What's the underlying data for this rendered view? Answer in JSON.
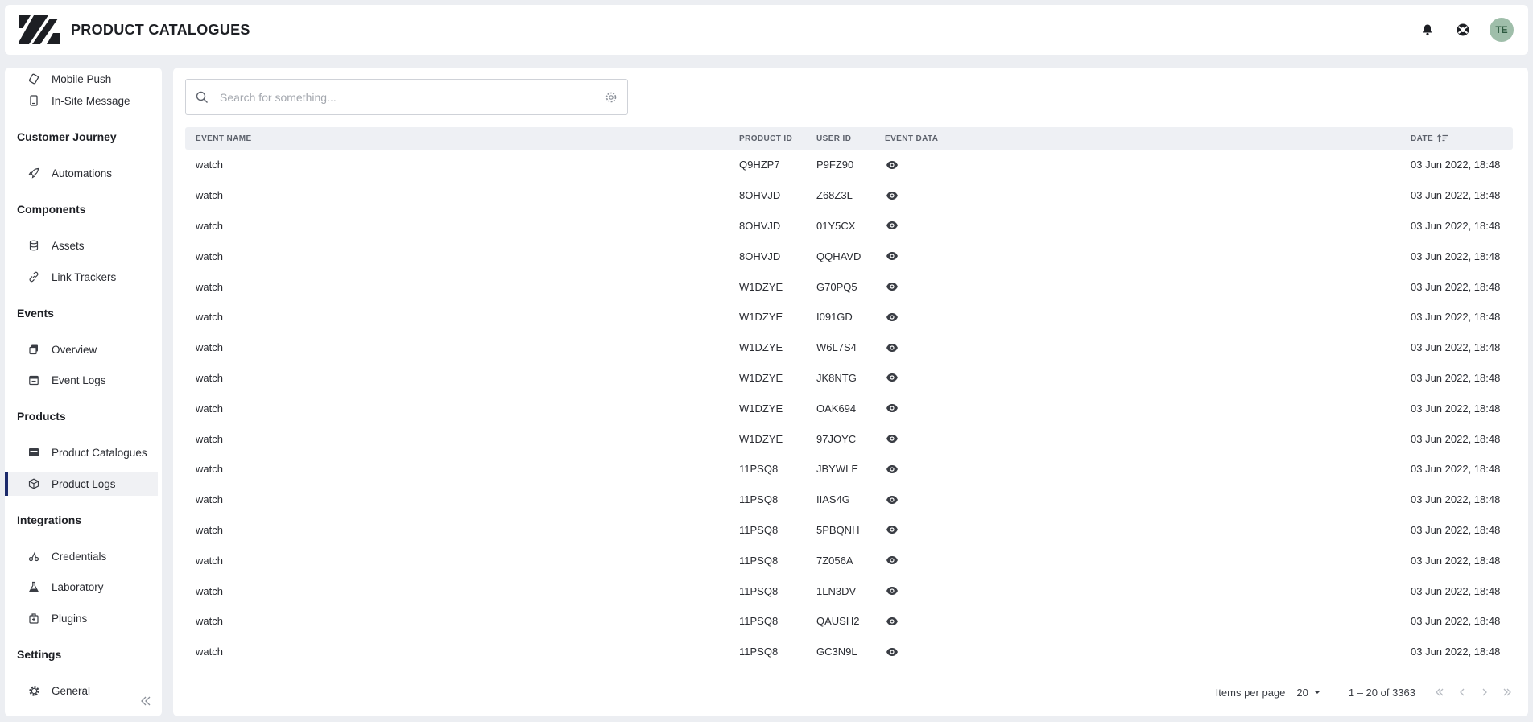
{
  "header": {
    "title": "PRODUCT CATALOGUES",
    "avatar_initials": "TE",
    "icons": [
      "bell-icon",
      "help-icon"
    ]
  },
  "sidebar": {
    "items_top": [
      {
        "label": "Mobile Push",
        "icon": "mobile-push-icon"
      },
      {
        "label": "In-Site Message",
        "icon": "tablet-icon"
      }
    ],
    "sections": [
      {
        "title": "Customer Journey",
        "items": [
          {
            "label": "Automations",
            "icon": "rocket-icon"
          }
        ]
      },
      {
        "title": "Components",
        "items": [
          {
            "label": "Assets",
            "icon": "database-icon"
          },
          {
            "label": "Link Trackers",
            "icon": "link-icon"
          }
        ]
      },
      {
        "title": "Events",
        "items": [
          {
            "label": "Overview",
            "icon": "layers-icon"
          },
          {
            "label": "Event Logs",
            "icon": "calendar-icon"
          }
        ]
      },
      {
        "title": "Products",
        "items": [
          {
            "label": "Product Catalogues",
            "icon": "catalog-icon"
          },
          {
            "label": "Product Logs",
            "icon": "cube-icon"
          }
        ]
      },
      {
        "title": "Integrations",
        "items": [
          {
            "label": "Credentials",
            "icon": "credentials-icon"
          },
          {
            "label": "Laboratory",
            "icon": "flask-icon"
          },
          {
            "label": "Plugins",
            "icon": "plugin-icon"
          }
        ]
      },
      {
        "title": "Settings",
        "items": [
          {
            "label": "General",
            "icon": "gear-icon"
          }
        ]
      }
    ],
    "active": "Product Logs"
  },
  "search": {
    "placeholder": "Search for something...",
    "value": ""
  },
  "table": {
    "columns": {
      "event_name": "EVENT NAME",
      "product_id": "PRODUCT ID",
      "user_id": "USER ID",
      "event_data": "EVENT DATA",
      "date": "DATE"
    },
    "rows": [
      {
        "event_name": "watch",
        "product_id": "Q9HZP7",
        "user_id": "P9FZ90",
        "date": "03 Jun 2022, 18:48"
      },
      {
        "event_name": "watch",
        "product_id": "8OHVJD",
        "user_id": "Z68Z3L",
        "date": "03 Jun 2022, 18:48"
      },
      {
        "event_name": "watch",
        "product_id": "8OHVJD",
        "user_id": "01Y5CX",
        "date": "03 Jun 2022, 18:48"
      },
      {
        "event_name": "watch",
        "product_id": "8OHVJD",
        "user_id": "QQHAVD",
        "date": "03 Jun 2022, 18:48"
      },
      {
        "event_name": "watch",
        "product_id": "W1DZYE",
        "user_id": "G70PQ5",
        "date": "03 Jun 2022, 18:48"
      },
      {
        "event_name": "watch",
        "product_id": "W1DZYE",
        "user_id": "I091GD",
        "date": "03 Jun 2022, 18:48"
      },
      {
        "event_name": "watch",
        "product_id": "W1DZYE",
        "user_id": "W6L7S4",
        "date": "03 Jun 2022, 18:48"
      },
      {
        "event_name": "watch",
        "product_id": "W1DZYE",
        "user_id": "JK8NTG",
        "date": "03 Jun 2022, 18:48"
      },
      {
        "event_name": "watch",
        "product_id": "W1DZYE",
        "user_id": "OAK694",
        "date": "03 Jun 2022, 18:48"
      },
      {
        "event_name": "watch",
        "product_id": "W1DZYE",
        "user_id": "97JOYC",
        "date": "03 Jun 2022, 18:48"
      },
      {
        "event_name": "watch",
        "product_id": "11PSQ8",
        "user_id": "JBYWLE",
        "date": "03 Jun 2022, 18:48"
      },
      {
        "event_name": "watch",
        "product_id": "11PSQ8",
        "user_id": "IIAS4G",
        "date": "03 Jun 2022, 18:48"
      },
      {
        "event_name": "watch",
        "product_id": "11PSQ8",
        "user_id": "5PBQNH",
        "date": "03 Jun 2022, 18:48"
      },
      {
        "event_name": "watch",
        "product_id": "11PSQ8",
        "user_id": "7Z056A",
        "date": "03 Jun 2022, 18:48"
      },
      {
        "event_name": "watch",
        "product_id": "11PSQ8",
        "user_id": "1LN3DV",
        "date": "03 Jun 2022, 18:48"
      },
      {
        "event_name": "watch",
        "product_id": "11PSQ8",
        "user_id": "QAUSH2",
        "date": "03 Jun 2022, 18:48"
      },
      {
        "event_name": "watch",
        "product_id": "11PSQ8",
        "user_id": "GC3N9L",
        "date": "03 Jun 2022, 18:48"
      }
    ]
  },
  "pagination": {
    "items_per_page_label": "Items per page",
    "items_per_page": "20",
    "range": "1 – 20 of 3363"
  },
  "colors": {
    "active_indicator": "#1c2a6b",
    "avatar_bg": "#9fbeaa"
  }
}
